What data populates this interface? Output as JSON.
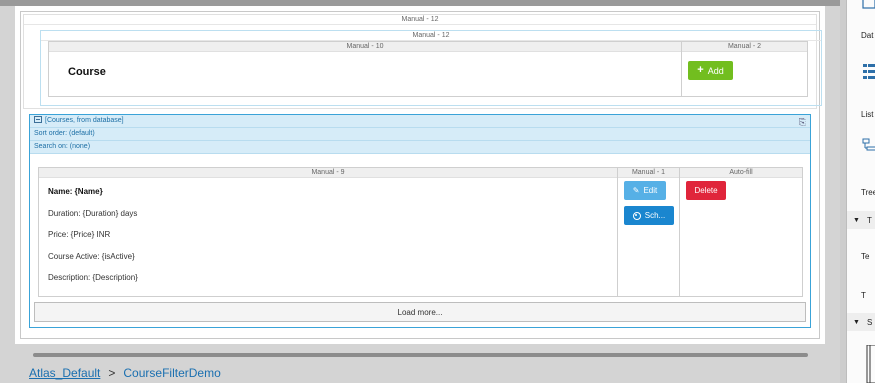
{
  "grid_blocks": {
    "outer": "Manual - 12",
    "inner": "Manual - 12",
    "col_left": "Manual - 10",
    "col_right": "Manual - 2"
  },
  "header": {
    "title": "Course",
    "add_button": "Add"
  },
  "list_view": {
    "source": "[Courses, from database]",
    "sort_order": "Sort order: (default)",
    "search_on": "Search on: (none)",
    "col_main": "Manual - 9",
    "col_buttons": "Manual - 1",
    "col_autofill": "Auto-fill",
    "fields": {
      "name": "Name: {Name}",
      "duration": "Duration: {Duration} days",
      "price": "Price: {Price} INR",
      "active": "Course Active: {isActive}",
      "description": "Description: {Description}"
    },
    "edit_button": "Edit",
    "schedule_button": "Sch...",
    "delete_button": "Delete",
    "load_more": "Load more..."
  },
  "breadcrumb": {
    "root": "Atlas_Default",
    "separator": ">",
    "page": "CourseFilterDemo"
  },
  "toolbox": {
    "item1": "Dat",
    "item2": "List",
    "item3": "Tree",
    "section1": "T",
    "sub1": "Te",
    "sub2": "T",
    "section2": "S"
  },
  "colors": {
    "add": "#72be1f",
    "edit": "#56b0e6",
    "schedule": "#1a86cf",
    "delete": "#e0253b",
    "selection": "#3aa3d8",
    "link": "#1a6fb0"
  }
}
